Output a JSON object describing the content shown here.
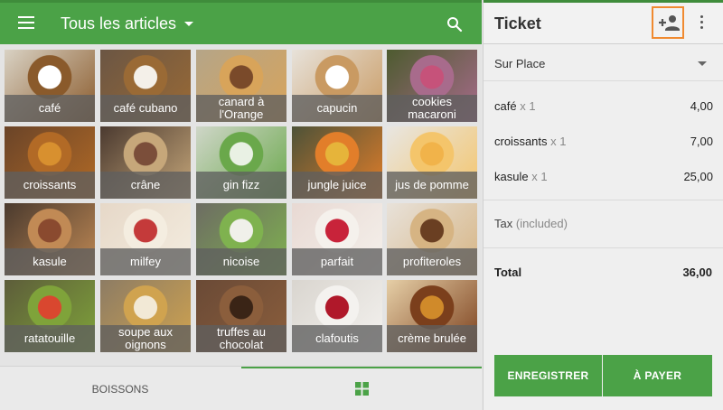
{
  "header": {
    "title": "Tous les articles"
  },
  "items": [
    {
      "label": "café",
      "colors": [
        "#d9d2c4",
        "#ffffff",
        "#8a5a2b"
      ]
    },
    {
      "label": "café cubano",
      "colors": [
        "#6b5644",
        "#f4f0e9",
        "#9a6a35"
      ]
    },
    {
      "label": "canard à l'Orange",
      "colors": [
        "#b5a588",
        "#7a4a2a",
        "#d8a45a"
      ]
    },
    {
      "label": "capucin",
      "colors": [
        "#e7e2da",
        "#ffffff",
        "#c99a62"
      ]
    },
    {
      "label": "cookies macaroni",
      "colors": [
        "#4d5b2f",
        "#c6527a",
        "#a86b8c"
      ]
    },
    {
      "label": "croissants",
      "colors": [
        "#6a4428",
        "#d8902f",
        "#b26a26"
      ]
    },
    {
      "label": "crâne",
      "colors": [
        "#4b3a30",
        "#7b4e3a",
        "#c6a77a"
      ]
    },
    {
      "label": "gin fizz",
      "colors": [
        "#cfd6c8",
        "#e9f1e4",
        "#6aa84b"
      ]
    },
    {
      "label": "jungle juice",
      "colors": [
        "#4d5238",
        "#e6b43a",
        "#e27e2a"
      ]
    },
    {
      "label": "jus de pomme",
      "colors": [
        "#e8e6e2",
        "#f1b34a",
        "#f4c56b"
      ]
    },
    {
      "label": "kasule",
      "colors": [
        "#4a3a2e",
        "#8a4a2f",
        "#c18a55"
      ]
    },
    {
      "label": "milfey",
      "colors": [
        "#e6d8c8",
        "#c43a3a",
        "#f4ede0"
      ]
    },
    {
      "label": "nicoise",
      "colors": [
        "#6d6c63",
        "#f0f0ea",
        "#7fb24f"
      ]
    },
    {
      "label": "parfait",
      "colors": [
        "#e8d9d3",
        "#c8233a",
        "#f5f1ec"
      ]
    },
    {
      "label": "profiteroles",
      "colors": [
        "#e8e2da",
        "#6a3f22",
        "#d6b483"
      ]
    },
    {
      "label": "ratatouille",
      "colors": [
        "#5d5d3a",
        "#d9472f",
        "#7fa33a"
      ]
    },
    {
      "label": "soupe aux oignons",
      "colors": [
        "#8d7c64",
        "#f2e9d6",
        "#d0a34f"
      ]
    },
    {
      "label": "truffes au chocolat",
      "colors": [
        "#6a4a36",
        "#3a2416",
        "#8b5e3c"
      ]
    },
    {
      "label": "clafoutis",
      "colors": [
        "#d9d5cf",
        "#b0182a",
        "#f4f2ef"
      ]
    },
    {
      "label": "crème brulée",
      "colors": [
        "#e6cfa7",
        "#d08a2a",
        "#7b3f1c"
      ]
    }
  ],
  "bottom_tabs": {
    "drinks": "BOISSONS"
  },
  "ticket": {
    "title": "Ticket",
    "dining_option": "Sur Place",
    "lines": [
      {
        "name": "café",
        "qty": "x 1",
        "price": "4,00"
      },
      {
        "name": "croissants",
        "qty": "x 1",
        "price": "7,00"
      },
      {
        "name": "kasule",
        "qty": "x 1",
        "price": "25,00"
      }
    ],
    "tax_label": "Tax",
    "tax_sub": "(included)",
    "total_label": "Total",
    "total_value": "36,00",
    "save_label": "ENREGISTRER",
    "pay_label": "À PAYER"
  },
  "colors": {
    "accent": "#4ba247",
    "highlight": "#f08a30"
  },
  "icons": [
    "menu-icon",
    "search-icon",
    "add-customer-icon",
    "more-vert-icon",
    "grid-icon"
  ]
}
